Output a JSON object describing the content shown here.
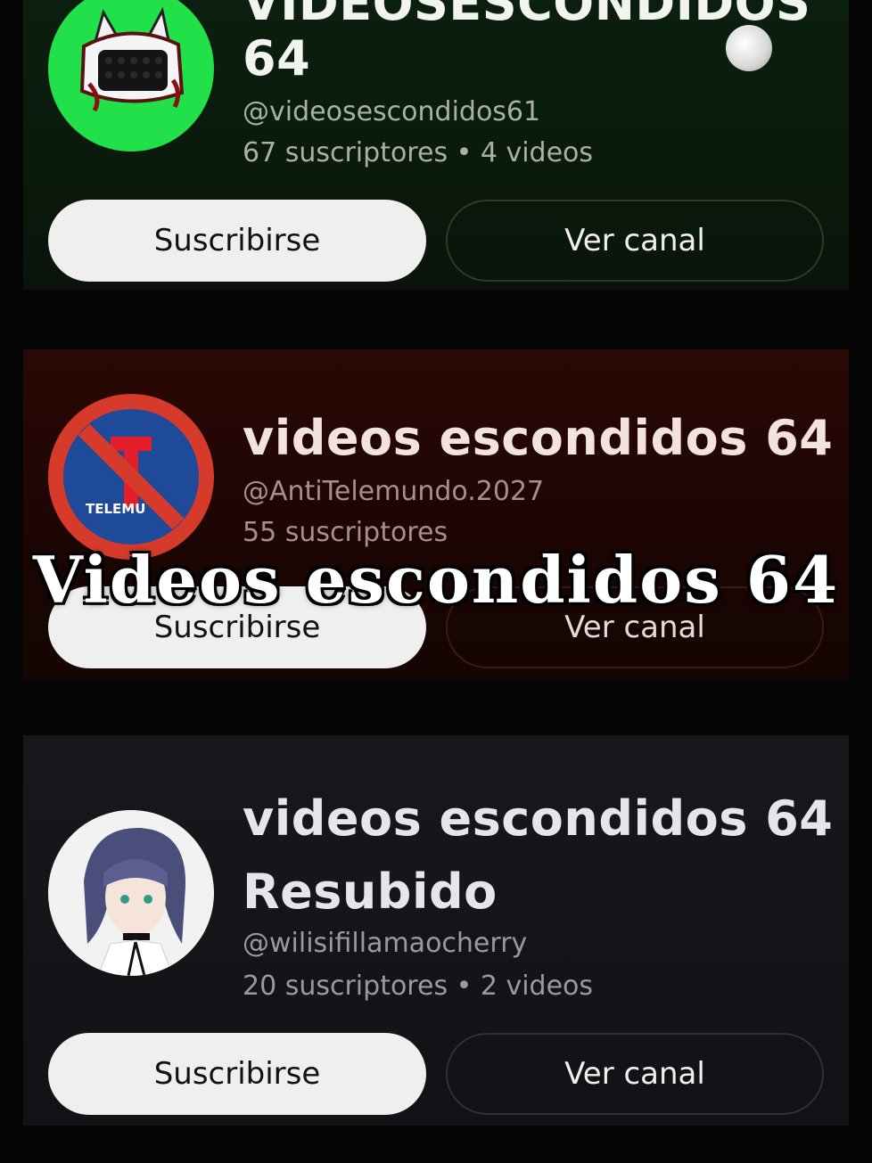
{
  "channels": [
    {
      "title_line1": "VIDEOSESCONDIDOS",
      "title_line2": "64",
      "handle": "@videosescondidos61",
      "stats": "67 suscriptores • 4 videos",
      "subscribe_label": "Suscribirse",
      "view_label": "Ver canal",
      "avatar_icon": "monster-face-icon",
      "accent": "#22e04a"
    },
    {
      "title_line1": "videos escondidos 64",
      "handle": "@AntiTelemundo.2027",
      "stats": "55 suscriptores",
      "subscribe_label": "Suscribirse",
      "view_label": "Ver canal",
      "avatar_text": "TELEMU",
      "avatar_icon": "prohibited-telemundo-icon",
      "accent": "#d63a2a"
    },
    {
      "title_line1": "videos escondidos 64",
      "title_line2": "Resubido",
      "handle": "@wilisifillamaocherry",
      "stats": "20 suscriptores • 2 videos",
      "subscribe_label": "Suscribirse",
      "view_label": "Ver canal",
      "avatar_icon": "anime-girl-avatar-icon"
    }
  ],
  "overlay_caption": "Videos escondidos 64"
}
